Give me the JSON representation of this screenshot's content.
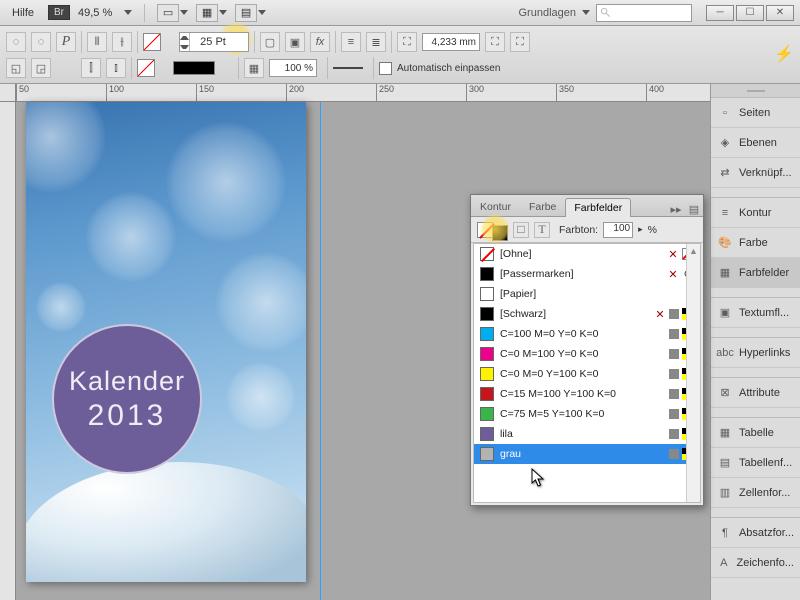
{
  "menu": {
    "help": "Hilfe",
    "br": "Br",
    "zoom": "49,5 %",
    "workspace": "Grundlagen"
  },
  "toolbar": {
    "font_size": "25 Pt",
    "opacity": "100 %",
    "mm": "4,233 mm",
    "auto_fit": "Automatisch einpassen"
  },
  "ruler": {
    "ticks": [
      "50",
      "100",
      "150",
      "200",
      "250",
      "300",
      "350",
      "400"
    ]
  },
  "doc": {
    "title1": "Kalender",
    "title2": "2013"
  },
  "panels": {
    "items": [
      {
        "label": "Seiten"
      },
      {
        "label": "Ebenen"
      },
      {
        "label": "Verknüpf..."
      },
      {
        "label": "Kontur"
      },
      {
        "label": "Farbe"
      },
      {
        "label": "Farbfelder"
      },
      {
        "label": "Textumfl..."
      },
      {
        "label": "Hyperlinks"
      },
      {
        "label": "Attribute"
      },
      {
        "label": "Tabelle"
      },
      {
        "label": "Tabellenf..."
      },
      {
        "label": "Zellenfor..."
      },
      {
        "label": "Absatzfor..."
      },
      {
        "label": "Zeichenfo..."
      }
    ]
  },
  "swatch_panel": {
    "tabs": [
      "Kontur",
      "Farbe",
      "Farbfelder"
    ],
    "active_tab": 2,
    "tint_label": "Farbton:",
    "tint_value": "100",
    "tint_suffix": "%",
    "swatches": [
      {
        "name": "[Ohne]",
        "color": "none",
        "icons": [
          "x",
          "none2"
        ]
      },
      {
        "name": "[Passermarken]",
        "color": "#000",
        "icons": [
          "x",
          "reg"
        ]
      },
      {
        "name": "[Papier]",
        "color": "#fff",
        "icons": []
      },
      {
        "name": "[Schwarz]",
        "color": "#000",
        "icons": [
          "x",
          "proc",
          "cmyk"
        ]
      },
      {
        "name": "C=100 M=0 Y=0 K=0",
        "color": "#00aeef",
        "icons": [
          "proc",
          "cmyk"
        ]
      },
      {
        "name": "C=0 M=100 Y=0 K=0",
        "color": "#ec008c",
        "icons": [
          "proc",
          "cmyk"
        ]
      },
      {
        "name": "C=0 M=0 Y=100 K=0",
        "color": "#fff200",
        "icons": [
          "proc",
          "cmyk"
        ]
      },
      {
        "name": "C=15 M=100 Y=100 K=0",
        "color": "#c4161c",
        "icons": [
          "proc",
          "cmyk"
        ]
      },
      {
        "name": "C=75 M=5 Y=100 K=0",
        "color": "#39b54a",
        "icons": [
          "proc",
          "cmyk"
        ]
      },
      {
        "name": "lila",
        "color": "#6d5e99",
        "icons": [
          "proc",
          "cmyk"
        ]
      },
      {
        "name": "grau",
        "color": "#b3b3b3",
        "icons": [
          "proc",
          "cmyk"
        ],
        "selected": true
      }
    ]
  }
}
